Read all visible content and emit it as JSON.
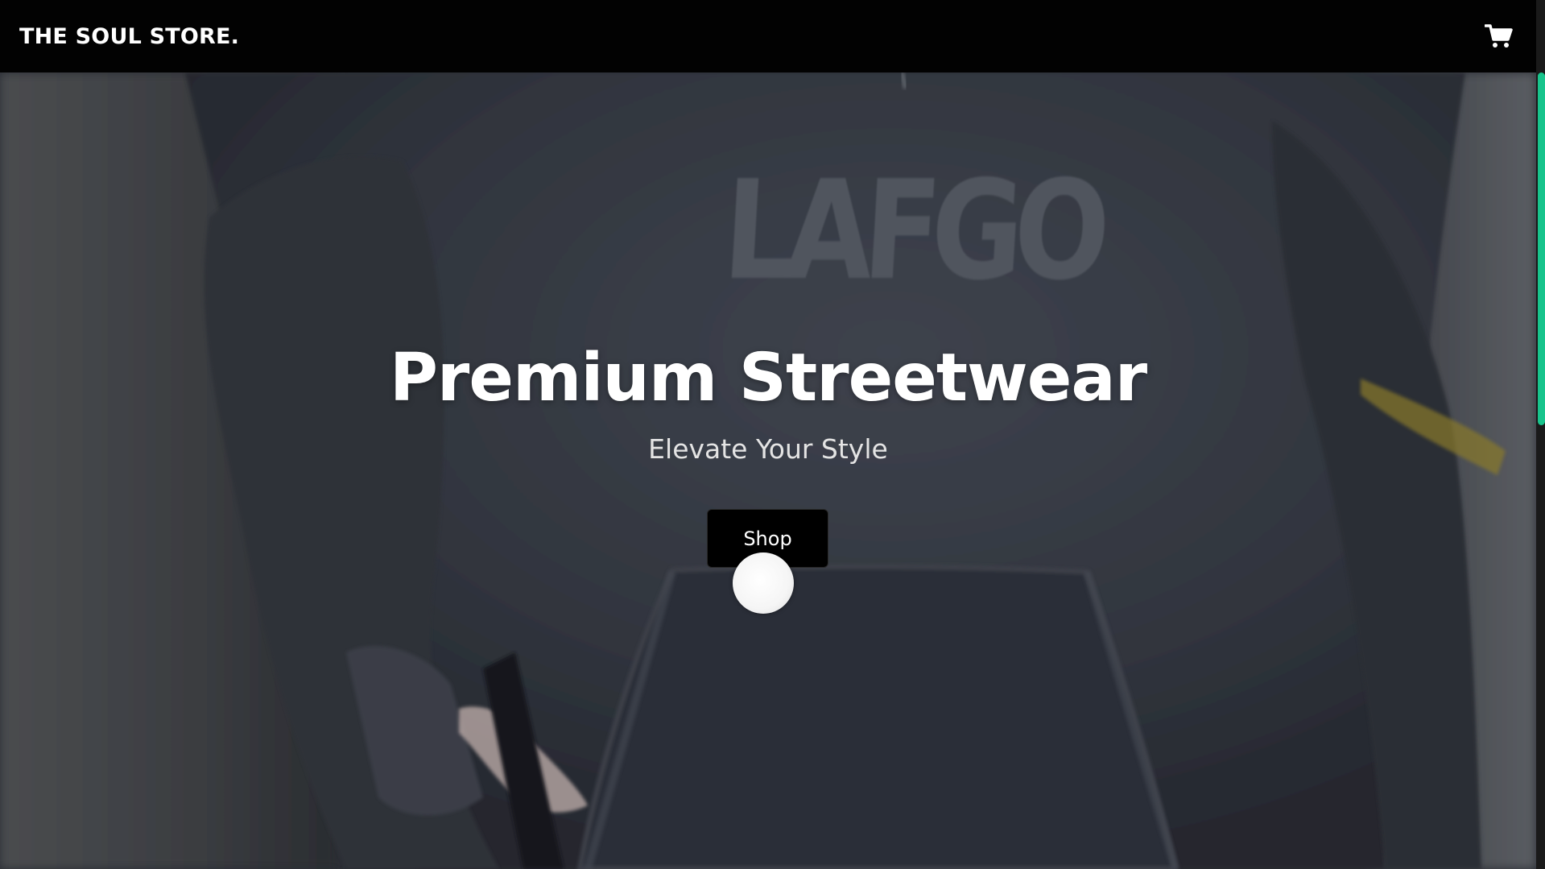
{
  "navbar": {
    "brand": "THE SOUL STORE.",
    "cart_icon": "shopping-cart-icon"
  },
  "hero": {
    "background_image_text": "LAFGO",
    "title": "Premium Streetwear",
    "subtitle": "Elevate Your Style",
    "cta_label": "Shop"
  },
  "colors": {
    "navbar_bg": "#020202",
    "scroll_thumb": "#18c48c",
    "button_bg": "#000000",
    "text_primary": "#ffffff"
  }
}
